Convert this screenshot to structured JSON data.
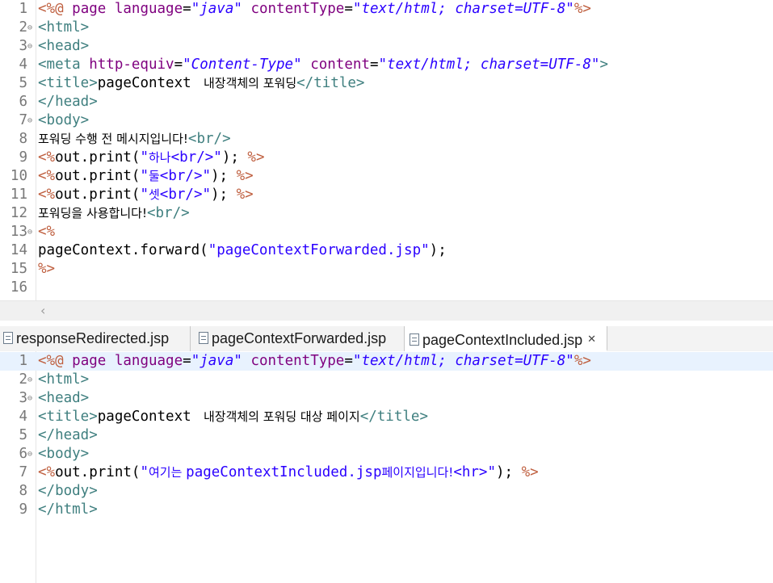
{
  "top_editor": {
    "lines": [
      {
        "n": "1",
        "fold": "",
        "segs": [
          [
            "dl",
            "<%@ "
          ],
          [
            "an",
            "page "
          ],
          [
            "an",
            "language"
          ],
          [
            "pl",
            "="
          ],
          [
            "av",
            "\"java\""
          ],
          [
            "pl",
            " "
          ],
          [
            "an",
            "contentType"
          ],
          [
            "pl",
            "="
          ],
          [
            "av",
            "\"text/html; charset=UTF-8\""
          ],
          [
            "dl",
            "%>"
          ]
        ]
      },
      {
        "n": "2",
        "fold": "⊖",
        "segs": [
          [
            "tg",
            "<html>"
          ]
        ]
      },
      {
        "n": "3",
        "fold": "⊖",
        "segs": [
          [
            "tg",
            "<head>"
          ]
        ]
      },
      {
        "n": "4",
        "fold": "",
        "segs": [
          [
            "tg",
            "<meta "
          ],
          [
            "an",
            "http-equiv"
          ],
          [
            "pl",
            "="
          ],
          [
            "av",
            "\"Content-Type\""
          ],
          [
            "pl",
            " "
          ],
          [
            "an",
            "content"
          ],
          [
            "pl",
            "="
          ],
          [
            "av",
            "\"text/html; charset=UTF-8\""
          ],
          [
            "tg",
            ">"
          ]
        ]
      },
      {
        "n": "5",
        "fold": "",
        "segs": [
          [
            "tg",
            "<title>"
          ],
          [
            "pl",
            "pageContext "
          ],
          [
            "kr",
            " 내장객체의 포워딩"
          ],
          [
            "tg",
            "</title>"
          ]
        ]
      },
      {
        "n": "6",
        "fold": "",
        "segs": [
          [
            "tg",
            "</head>"
          ]
        ]
      },
      {
        "n": "7",
        "fold": "⊖",
        "segs": [
          [
            "tg",
            "<body>"
          ]
        ]
      },
      {
        "n": "8",
        "fold": "",
        "segs": [
          [
            "kr",
            "포워딩 수행 전 메시지입니다!"
          ],
          [
            "tg",
            "<br/>"
          ]
        ]
      },
      {
        "n": "9",
        "fold": "",
        "segs": [
          [
            "dl",
            "<%"
          ],
          [
            "pl",
            "out.print("
          ],
          [
            "st",
            "\""
          ],
          [
            "krs",
            "하나"
          ],
          [
            "st",
            "<br/>\""
          ],
          [
            "pl",
            "); "
          ],
          [
            "dl",
            "%>"
          ]
        ]
      },
      {
        "n": "10",
        "fold": "",
        "segs": [
          [
            "dl",
            "<%"
          ],
          [
            "pl",
            "out.print("
          ],
          [
            "st",
            "\""
          ],
          [
            "krs",
            "둘"
          ],
          [
            "st",
            "<br/>\""
          ],
          [
            "pl",
            "); "
          ],
          [
            "dl",
            "%>"
          ]
        ]
      },
      {
        "n": "11",
        "fold": "",
        "segs": [
          [
            "dl",
            "<%"
          ],
          [
            "pl",
            "out.print("
          ],
          [
            "st",
            "\""
          ],
          [
            "krs",
            "셋"
          ],
          [
            "st",
            "<br/>\""
          ],
          [
            "pl",
            "); "
          ],
          [
            "dl",
            "%>"
          ]
        ]
      },
      {
        "n": "12",
        "fold": "",
        "segs": [
          [
            "kr",
            "포워딩을 사용합니다!"
          ],
          [
            "tg",
            "<br/>"
          ]
        ]
      },
      {
        "n": "13",
        "fold": "⊖",
        "segs": [
          [
            "dl",
            "<%"
          ]
        ]
      },
      {
        "n": "14",
        "fold": "",
        "segs": [
          [
            "pl",
            "pageContext.forward("
          ],
          [
            "st",
            "\"pageContextForwarded.jsp\""
          ],
          [
            "pl",
            ");"
          ]
        ]
      },
      {
        "n": "15",
        "fold": "",
        "segs": [
          [
            "dl",
            "%>"
          ]
        ]
      },
      {
        "n": "16",
        "fold": "",
        "segs": []
      }
    ]
  },
  "scroll_left_glyph": "‹",
  "tabs": [
    {
      "label": "responseRedirected.jsp",
      "close": ""
    },
    {
      "label": "pageContextForwarded.jsp",
      "close": ""
    },
    {
      "label": "pageContextIncluded.jsp",
      "close": "✕"
    }
  ],
  "bottom_editor": {
    "lines": [
      {
        "n": "1",
        "fold": "",
        "segs": [
          [
            "dl",
            "<%@ "
          ],
          [
            "an",
            "page "
          ],
          [
            "an",
            "language"
          ],
          [
            "pl",
            "="
          ],
          [
            "av",
            "\"java\""
          ],
          [
            "pl",
            " "
          ],
          [
            "an",
            "contentType"
          ],
          [
            "pl",
            "="
          ],
          [
            "av",
            "\"text/html; charset=UTF-8\""
          ],
          [
            "dl",
            "%>"
          ]
        ]
      },
      {
        "n": "2",
        "fold": "⊖",
        "segs": [
          [
            "tg",
            "<html>"
          ]
        ]
      },
      {
        "n": "3",
        "fold": "⊖",
        "segs": [
          [
            "tg",
            "<head>"
          ]
        ]
      },
      {
        "n": "4",
        "fold": "",
        "segs": [
          [
            "tg",
            "<title>"
          ],
          [
            "pl",
            "pageContext "
          ],
          [
            "kr",
            " 내장객체의 포워딩 대상 페이지"
          ],
          [
            "tg",
            "</title>"
          ]
        ]
      },
      {
        "n": "5",
        "fold": "",
        "segs": [
          [
            "tg",
            "</head>"
          ]
        ]
      },
      {
        "n": "6",
        "fold": "⊖",
        "segs": [
          [
            "tg",
            "<body>"
          ]
        ]
      },
      {
        "n": "7",
        "fold": "",
        "segs": [
          [
            "dl",
            "<%"
          ],
          [
            "pl",
            "out.print("
          ],
          [
            "st",
            "\""
          ],
          [
            "krs",
            "여기는 "
          ],
          [
            "st",
            "pageContextIncluded.jsp"
          ],
          [
            "krs",
            "페이지입니다!"
          ],
          [
            "st",
            "<hr>\""
          ],
          [
            "pl",
            "); "
          ],
          [
            "dl",
            "%>"
          ]
        ]
      },
      {
        "n": "8",
        "fold": "",
        "segs": [
          [
            "tg",
            "</body>"
          ]
        ]
      },
      {
        "n": "9",
        "fold": "",
        "segs": [
          [
            "tg",
            "</html>"
          ]
        ]
      }
    ]
  }
}
